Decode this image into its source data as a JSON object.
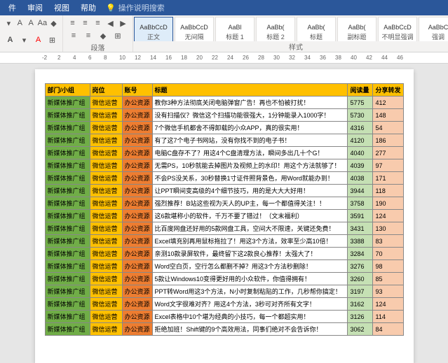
{
  "tabs": [
    "件",
    "审阅",
    "视图",
    "帮助"
  ],
  "help_search": "操作说明搜索",
  "group_labels": {
    "para": "段落",
    "styles": "样式"
  },
  "styles": [
    {
      "preview": "AaBbCcD",
      "name": "正文"
    },
    {
      "preview": "AaBbCcD",
      "name": "无间隔"
    },
    {
      "preview": "AaBl",
      "name": "标题 1"
    },
    {
      "preview": "AaBb(",
      "name": "标题 2"
    },
    {
      "preview": "AaBb(",
      "name": "标题"
    },
    {
      "preview": "AaBb(",
      "name": "副标题"
    },
    {
      "preview": "AaBbCcD",
      "name": "不明显强调"
    },
    {
      "preview": "AaBbC",
      "name": "强调"
    }
  ],
  "ruler": [
    -2,
    2,
    4,
    6,
    8,
    10,
    12,
    14,
    16,
    18,
    20,
    22,
    24,
    26,
    28,
    30,
    32,
    34,
    36,
    38,
    40,
    42,
    44,
    46
  ],
  "headers": [
    "部门/小组",
    "岗位",
    "账号",
    "标题",
    "阅读量",
    "分享转发"
  ],
  "rows": [
    [
      "新媒体推广组",
      "微信运营",
      "办公资源",
      "教你3种方法彻底关闭电脑弹窗广告！再也不怕被打扰！",
      "5775",
      "412"
    ],
    [
      "新媒体推广组",
      "微信运营",
      "办公资源",
      "没有扫描仪？微信这个扫描功能很强大，1分钟能录入1000字！",
      "5730",
      "148"
    ],
    [
      "新媒体推广组",
      "微信运营",
      "办公资源",
      "7个微信手机都舍不得卸载的小众APP，真的很实用！",
      "4316",
      "54"
    ],
    [
      "新媒体推广组",
      "微信运营",
      "办公资源",
      "有了这7个电子书网站，没有你找不到的电子书！",
      "4120",
      "186"
    ],
    [
      "新媒体推广组",
      "微信运营",
      "办公资源",
      "电脑C盘存不了？用这4个C盘清理方法，瞬间多出几十个G！",
      "4040",
      "277"
    ],
    [
      "新媒体推广组",
      "微信运营",
      "办公资源",
      "无需PS，10秒就能去掉图片及视频上的水印！用这个方法就够了！",
      "4039",
      "97"
    ],
    [
      "新媒体推广组",
      "微信运营",
      "办公资源",
      "不会PS没关系，30秒替换1寸证件照背景色，用Word就能办到！",
      "4038",
      "171"
    ],
    [
      "新媒体推广组",
      "微信运营",
      "办公资源",
      "让PPT瞬间变高级的4个细节技巧，用的是大大大好用！",
      "3944",
      "118"
    ],
    [
      "新媒体推广组",
      "微信运营",
      "办公资源",
      "强烈推荐！B站这些视为天人的UP主，每一个都值得关注！！",
      "3758",
      "190"
    ],
    [
      "新媒体推广组",
      "微信运营",
      "办公资源",
      "这6款堪称小的软件，千万不要了错过！（文末福利）",
      "3591",
      "124"
    ],
    [
      "新媒体推广组",
      "微信运营",
      "办公资源",
      "比百度网盘还好用的5款网盘工具，空间大不限速，关键还免费！",
      "3431",
      "130"
    ],
    [
      "新媒体推广组",
      "微信运营",
      "办公资源",
      "Excel填充别再用鼠标拖拉了！用这3个方法，效率至少高10倍！",
      "3388",
      "83"
    ],
    [
      "新媒体推广组",
      "微信运营",
      "办公资源",
      "亲测10款录屏软件，最终留下这2款良心推荐！太强大了！",
      "3284",
      "70"
    ],
    [
      "新媒体推广组",
      "微信运营",
      "办公资源",
      "Word空白页，空行怎么都删不掉？用这3个方法秒删除！",
      "3276",
      "98"
    ],
    [
      "新媒体推广组",
      "微信运营",
      "办公资源",
      "5款让Windows10变得更好用的小众软件，你值得拥有！",
      "3260",
      "85"
    ],
    [
      "新媒体推广组",
      "微信运营",
      "办公资源",
      "PPT转Word用这3个方法，N小时复制粘贴的工作，几秒帮你搞定！",
      "3197",
      "93"
    ],
    [
      "新媒体推广组",
      "微信运营",
      "办公资源",
      "Word文字很难对齐？用这4个方法，3秒可对齐所有文字！",
      "3162",
      "124"
    ],
    [
      "新媒体推广组",
      "微信运营",
      "办公资源",
      "Excel表格中10个堪为经典的小技巧，每一个都超实用！",
      "3126",
      "114"
    ],
    [
      "新媒体推广组",
      "微信运营",
      "办公资源",
      "拒绝加班！Shift键的9个高效用法，同事们绝对不会告诉你！",
      "3062",
      "84"
    ]
  ]
}
